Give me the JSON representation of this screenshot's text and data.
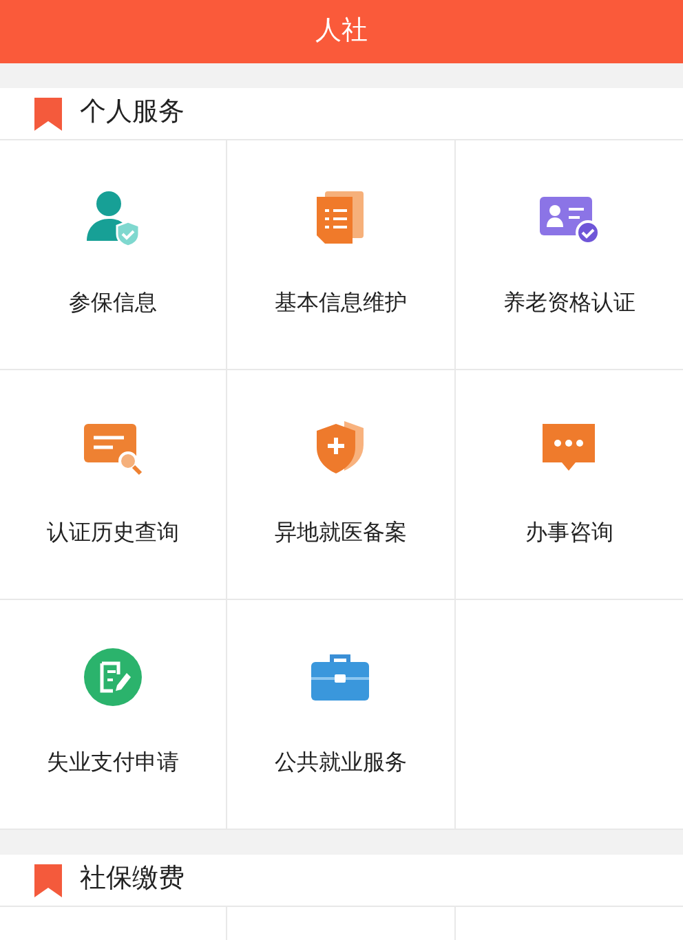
{
  "header": {
    "title": "人社"
  },
  "sections": [
    {
      "title": "个人服务",
      "items": [
        {
          "label": "参保信息"
        },
        {
          "label": "基本信息维护"
        },
        {
          "label": "养老资格认证"
        },
        {
          "label": "认证历史查询"
        },
        {
          "label": "异地就医备案"
        },
        {
          "label": "办事咨询"
        },
        {
          "label": "失业支付申请"
        },
        {
          "label": "公共就业服务"
        }
      ]
    },
    {
      "title": "社保缴费"
    }
  ]
}
